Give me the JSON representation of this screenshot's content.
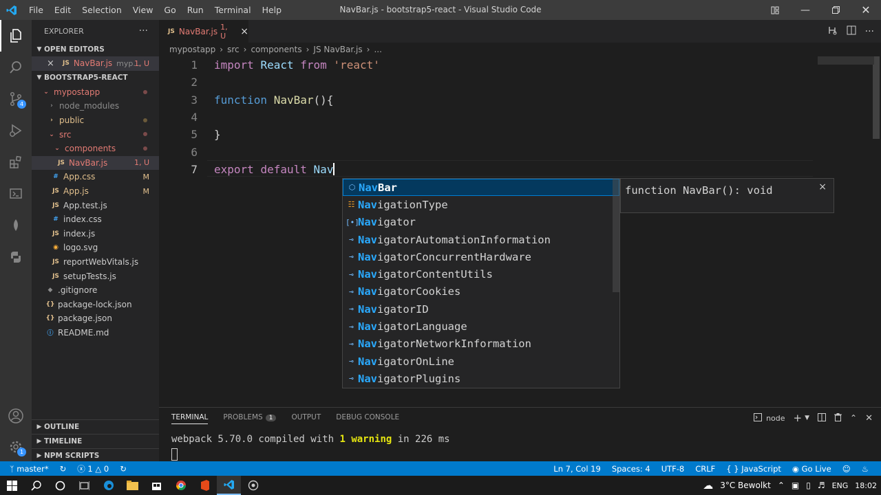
{
  "titlebar": {
    "menu": [
      "File",
      "Edit",
      "Selection",
      "View",
      "Go",
      "Run",
      "Terminal",
      "Help"
    ],
    "title": "NavBar.js - bootstrap5-react - Visual Studio Code"
  },
  "activity": {
    "source_control_badge": "4",
    "accounts_badge": "1"
  },
  "sidebar": {
    "header": "EXPLORER",
    "more": "···",
    "open_editors_title": "OPEN EDITORS",
    "open_editor": {
      "close": "×",
      "icon": "JS",
      "name": "NavBar.js",
      "path": "myp...",
      "status": "1, U"
    },
    "project_title": "BOOTSTRAP5-REACT",
    "tree": [
      {
        "label": "mypostapp",
        "icon": "⌄",
        "status": ""
      },
      {
        "label": "node_modules",
        "icon": "›",
        "status": ""
      },
      {
        "label": "public",
        "icon": "›",
        "status": ""
      },
      {
        "label": "src",
        "icon": "⌄",
        "status": ""
      },
      {
        "label": "components",
        "icon": "⌄",
        "status": ""
      },
      {
        "label": "NavBar.js",
        "icon": "JS",
        "status": "1, U"
      },
      {
        "label": "App.css",
        "icon": "#",
        "status": "M"
      },
      {
        "label": "App.js",
        "icon": "JS",
        "status": "M"
      },
      {
        "label": "App.test.js",
        "icon": "JS",
        "status": ""
      },
      {
        "label": "index.css",
        "icon": "#",
        "status": ""
      },
      {
        "label": "index.js",
        "icon": "JS",
        "status": ""
      },
      {
        "label": "logo.svg",
        "icon": "◉",
        "status": ""
      },
      {
        "label": "reportWebVitals.js",
        "icon": "JS",
        "status": ""
      },
      {
        "label": "setupTests.js",
        "icon": "JS",
        "status": ""
      },
      {
        "label": ".gitignore",
        "icon": "◆",
        "status": ""
      },
      {
        "label": "package-lock.json",
        "icon": "{}",
        "status": ""
      },
      {
        "label": "package.json",
        "icon": "{}",
        "status": ""
      },
      {
        "label": "README.md",
        "icon": "ⓘ",
        "status": ""
      }
    ],
    "sections": [
      "OUTLINE",
      "TIMELINE",
      "NPM SCRIPTS"
    ]
  },
  "tab": {
    "icon": "JS",
    "name": "NavBar.js",
    "status": "1, U",
    "close": "×"
  },
  "breadcrumb": [
    "mypostapp",
    "src",
    "components",
    "JS NavBar.js",
    "..."
  ],
  "code": {
    "line_numbers": [
      "1",
      "2",
      "3",
      "4",
      "5",
      "6",
      "7"
    ],
    "l1": {
      "a": "import",
      "b": "React",
      "c": "from",
      "d": "'react'"
    },
    "l3": {
      "a": "function",
      "b": "NavBar",
      "c": "(){"
    },
    "l5": "}",
    "l7": {
      "a": "export",
      "b": "default",
      "c": "Nav"
    }
  },
  "suggest": {
    "typed": "Nav",
    "items": [
      {
        "icon": "⬡",
        "rest": "Bar"
      },
      {
        "icon": "☷",
        "rest": "igationType"
      },
      {
        "icon": "[•]",
        "rest": "igator"
      },
      {
        "icon": "⊸",
        "rest": "igatorAutomationInformation"
      },
      {
        "icon": "⊸",
        "rest": "igatorConcurrentHardware"
      },
      {
        "icon": "⊸",
        "rest": "igatorContentUtils"
      },
      {
        "icon": "⊸",
        "rest": "igatorCookies"
      },
      {
        "icon": "⊸",
        "rest": "igatorID"
      },
      {
        "icon": "⊸",
        "rest": "igatorLanguage"
      },
      {
        "icon": "⊸",
        "rest": "igatorNetworkInformation"
      },
      {
        "icon": "⊸",
        "rest": "igatorOnLine"
      },
      {
        "icon": "⊸",
        "rest": "igatorPlugins"
      }
    ],
    "detail": "function NavBar(): void",
    "detail_close": "×"
  },
  "panel": {
    "tabs": [
      "TERMINAL",
      "PROBLEMS",
      "OUTPUT",
      "DEBUG CONSOLE"
    ],
    "problems_count": "1",
    "shell": "node",
    "terminal": {
      "pre": "webpack 5.70.0 compiled with ",
      "count": "1",
      "word": "warning",
      "post": " in 226 ms"
    }
  },
  "status": {
    "branch": "master*",
    "errors": "1",
    "warnings": "0",
    "position": "Ln 7, Col 19",
    "spaces": "Spaces: 4",
    "encoding": "UTF-8",
    "eol": "CRLF",
    "language": "JavaScript",
    "golive": "Go Live"
  },
  "taskbar": {
    "weather": "3°C Bewolkt",
    "lang": "ENG",
    "time": "18:02"
  },
  "colors": {
    "statusbar": "#007acc",
    "accent": "#007fd4",
    "git_untracked": "#e37b74",
    "git_modified": "#e2c08d"
  }
}
